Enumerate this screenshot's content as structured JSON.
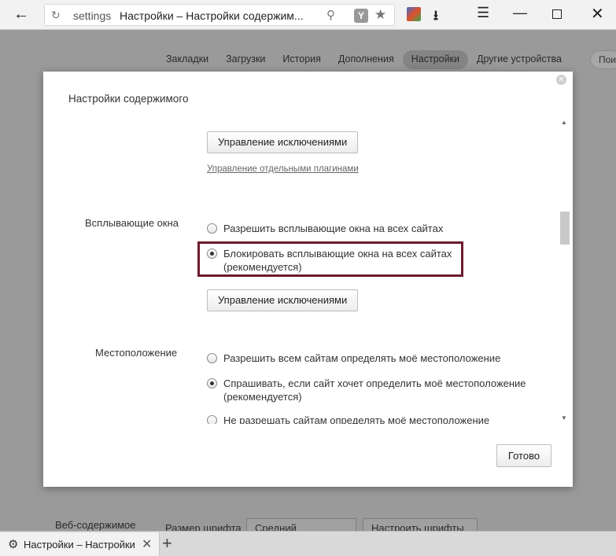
{
  "browser": {
    "omnibox_host": "settings",
    "omnibox_title": "Настройки – Настройки содержим...",
    "icons": {
      "back": "arrow-left-icon",
      "reload": "reload-icon",
      "search": "search-icon",
      "yandex": "yandex-icon",
      "bookmark": "star-icon",
      "extension": "extension-icon",
      "download": "download-icon",
      "menu": "hamburger-menu-icon",
      "minimize": "minimize-icon",
      "maximize": "maximize-icon",
      "close": "close-icon"
    }
  },
  "settings_nav": {
    "items": [
      {
        "label": "Закладки"
      },
      {
        "label": "Загрузки"
      },
      {
        "label": "История"
      },
      {
        "label": "Дополнения"
      },
      {
        "label": "Настройки",
        "active": true
      },
      {
        "label": "Другие устройства"
      }
    ],
    "search_placeholder": "Поис"
  },
  "background_row": {
    "label": "Веб-содержимое",
    "font_size_label": "Размер шрифта",
    "font_size_value": "Средний",
    "customize_fonts_button": "Настроить шрифты"
  },
  "dialog": {
    "title": "Настройки содержимого",
    "plugins_exceptions_button": "Управление исключениями",
    "plugins_link": "Управление отдельными плагинами",
    "popups": {
      "label": "Всплывающие окна",
      "options": [
        {
          "text": "Разрешить всплывающие окна на всех сайтах",
          "checked": false
        },
        {
          "text": "Блокировать всплывающие окна на всех сайтах",
          "text2": "(рекомендуется)",
          "checked": true
        }
      ],
      "exceptions_button": "Управление исключениями"
    },
    "location": {
      "label": "Местоположение",
      "options": [
        {
          "text": "Разрешить всем сайтам определять моё местоположение",
          "checked": false
        },
        {
          "text": "Спрашивать, если сайт хочет определить моё местоположение",
          "text2": "(рекомендуется)",
          "checked": true
        },
        {
          "text": "Не разрешать сайтам определять моё местоположение",
          "checked": false
        }
      ]
    },
    "done_button": "Готово"
  },
  "tabs": [
    {
      "title": "Настройки – Настройки содерж",
      "icon": "gear-icon"
    }
  ],
  "colors": {
    "highlight_border": "#6b1b2e",
    "overlay": "#9a9a9a"
  }
}
